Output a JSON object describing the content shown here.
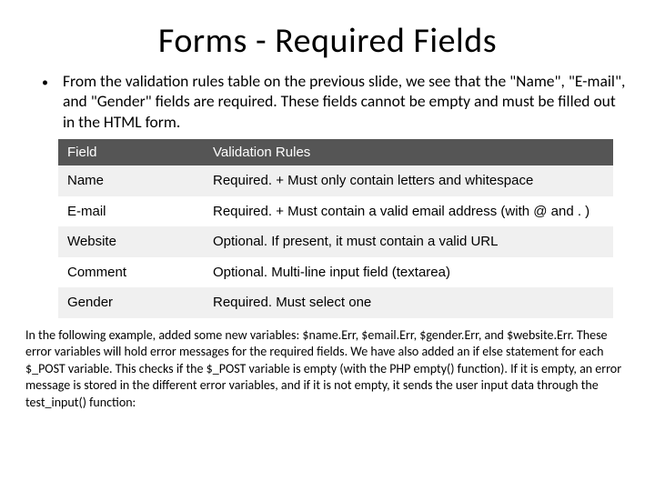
{
  "title": "Forms - Required Fields",
  "bullet": "From the validation rules table on the previous slide, we see that the \"Name\", \"E-mail\", and \"Gender\" fields are required. These fields cannot be empty and must be filled out in the HTML form.",
  "table": {
    "headers": {
      "field": "Field",
      "rules": "Validation Rules"
    },
    "rows": [
      {
        "field": "Name",
        "rules": "Required. + Must only contain letters and whitespace"
      },
      {
        "field": "E-mail",
        "rules": "Required. + Must contain a valid email address (with @ and . )"
      },
      {
        "field": "Website",
        "rules": "Optional. If present, it must contain a valid URL"
      },
      {
        "field": "Comment",
        "rules": "Optional. Multi-line input field (textarea)"
      },
      {
        "field": "Gender",
        "rules": "Required. Must select one"
      }
    ]
  },
  "paragraph": "In the following example, added some new variables: $name.Err, $email.Err, $gender.Err, and $website.Err. These error variables will hold error messages for the required fields. We have also added an if else statement for each $_POST variable. This checks if the $_POST variable is empty (with the PHP empty() function). If it is empty, an error message is stored in the different error variables, and if it is not empty, it sends the user input data through the test_input() function:"
}
